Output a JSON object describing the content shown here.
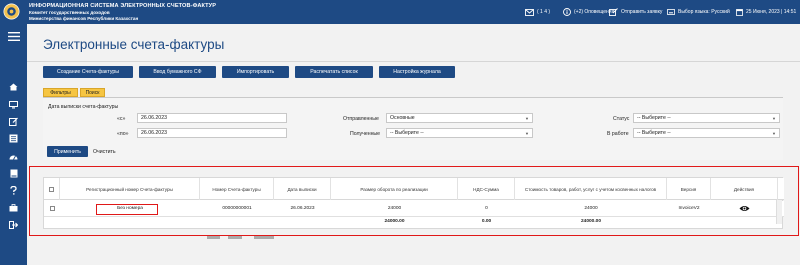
{
  "header": {
    "title_line1": "ИНФОРМАЦИОННАЯ СИСТЕМА ЭЛЕКТРОННЫХ СЧЕТОВ-ФАКТУР",
    "title_line2": "Комитет государственных доходов",
    "title_line3": "Министерства финансов Республики Казахстан",
    "messages": "( 1 4 )",
    "notifications": "(+2) Оповещения",
    "send_idea": "Отправить заявку",
    "language": "Выбор языка: Русский",
    "datetime": "25 Июня, 2023 | 14:51"
  },
  "page": {
    "title": "Электронные счета-фактуры"
  },
  "actions": [
    "Создание Счета-фактуры",
    "Ввод бумажного СФ",
    "Импортировать",
    "Распечатать список",
    "Настройка журнала"
  ],
  "tabs": [
    "Фильтры",
    "Поиск"
  ],
  "filters": {
    "date_label": "Дата выписки счета-фактуры",
    "from_label": "«с»",
    "from_value": "26.06.2023",
    "to_label": "«по»",
    "to_value": "26.06.2023",
    "sent_label": "Отправленные",
    "sent_value": "Основные",
    "received_label": "Полученные",
    "received_value": "-- Выберите --",
    "status_label": "Статус",
    "status_value": "-- Выберите --",
    "inwork_label": "В работе",
    "inwork_value": "-- Выберите --",
    "apply": "Применить",
    "clear": "Очистить"
  },
  "table": {
    "columns": [
      "Регистрационный номер Счета-фактуры",
      "Номер Счета-фактуры",
      "Дата выписки",
      "Размер оборота по реализации",
      "НДС-Сумма",
      "Стоимость товаров, работ, услуг с учетом косвенных налогов",
      "Версия",
      "Действия"
    ],
    "rows": [
      {
        "reg_number": "Без номера",
        "number": "00000000001",
        "date": "26.06.2023",
        "turnover": "24000",
        "vat": "0",
        "cost": "24000",
        "version": "InvoiceV2"
      }
    ],
    "totals": {
      "turnover": "24000.00",
      "vat": "0.00",
      "cost": "24000.00"
    }
  }
}
